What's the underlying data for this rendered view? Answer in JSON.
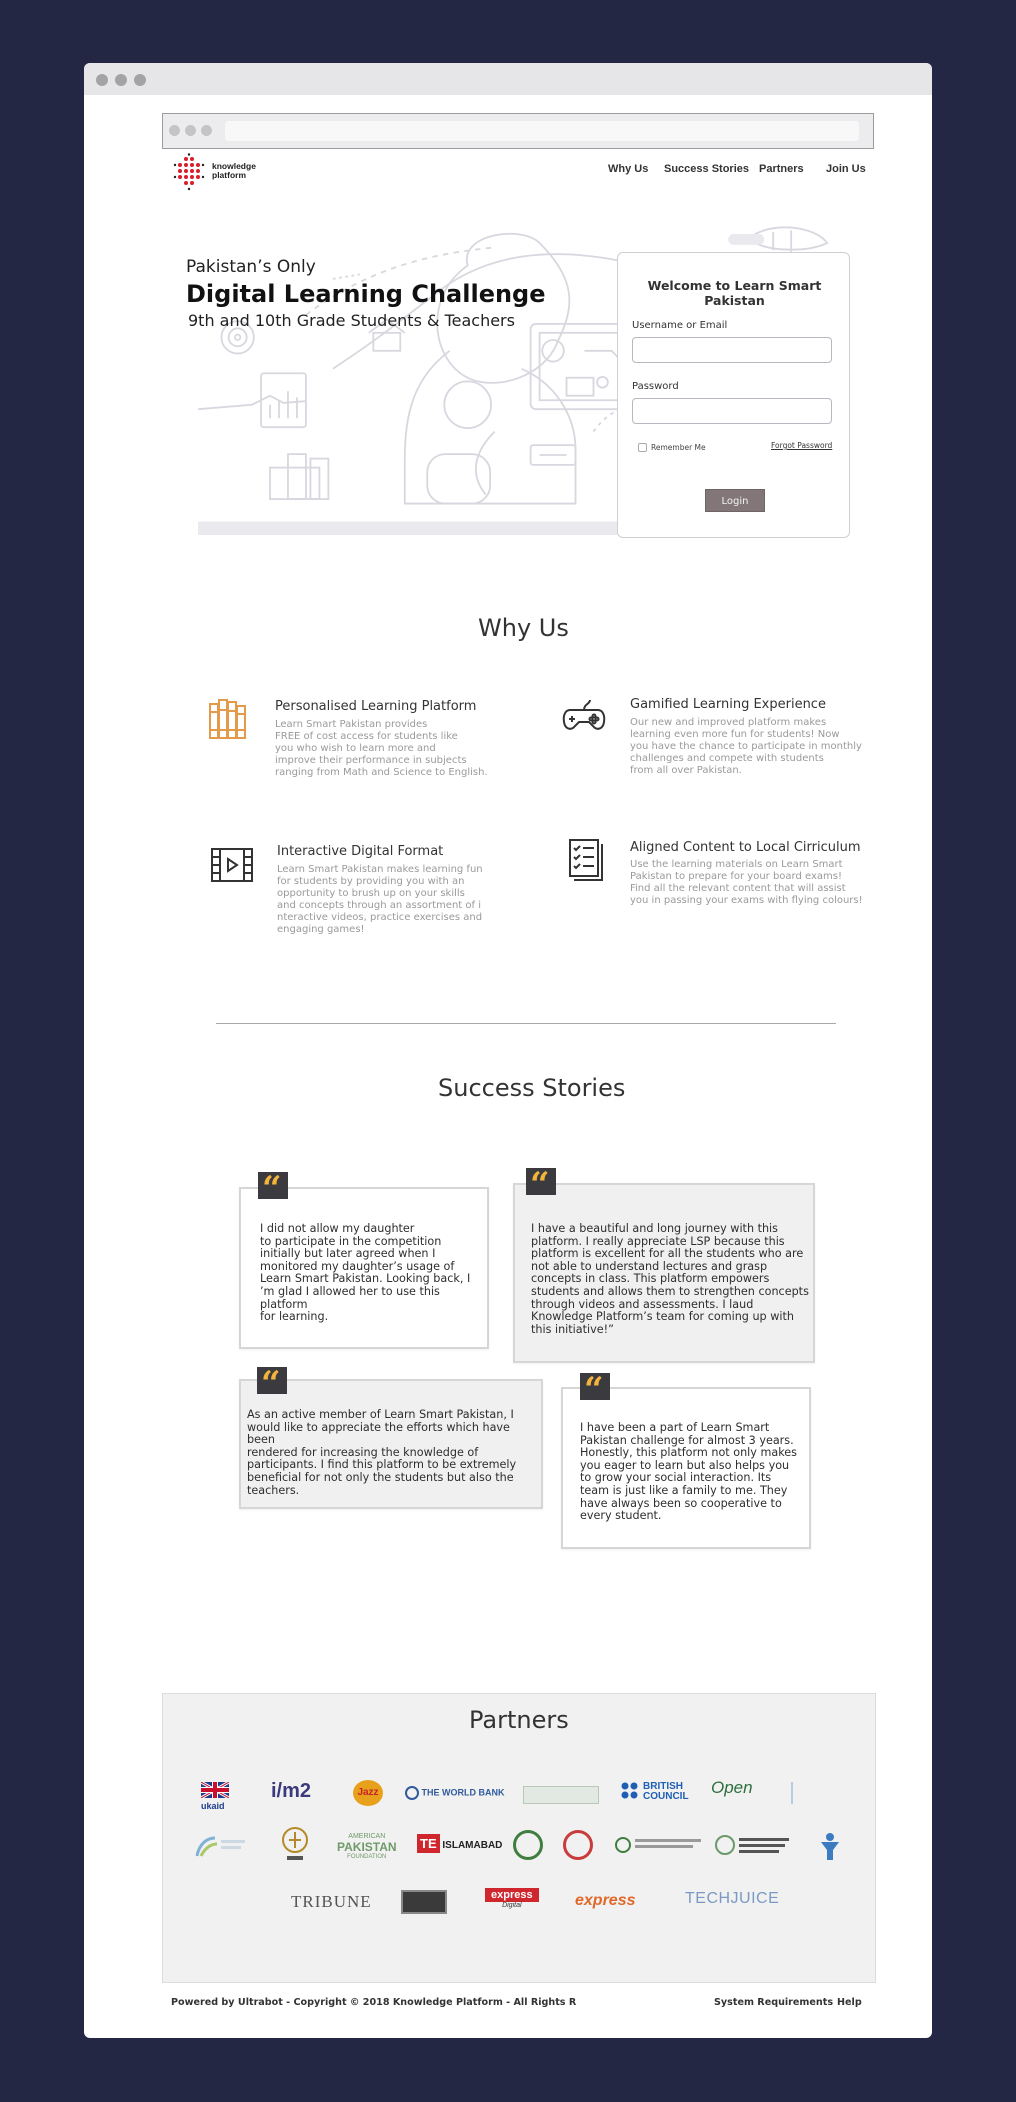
{
  "nav": {
    "why_us": "Why Us",
    "success_stories": "Success Stories",
    "partners": "Partners",
    "join_us": "Join Us"
  },
  "logo": {
    "line1": "knowledge",
    "line2": "platform"
  },
  "hero": {
    "line1": "Pakistan’s Only",
    "line2": "Digital Learning Challenge",
    "line3": "9th and 10th Grade Students & Teachers"
  },
  "login": {
    "title": "Welcome to Learn Smart Pakistan",
    "username_label": "Username or Email",
    "password_label": "Password",
    "remember_label": "Remember Me",
    "forgot_label": "Forgot Password",
    "button_label": "Login"
  },
  "why_us": {
    "title": "Why Us",
    "features": [
      {
        "title": "Personalised Learning Platform",
        "desc_lines": [
          "Learn Smart Pakistan provides",
          "FREE of cost access for students like",
          "you who wish to learn more and",
          "improve their performance in subjects",
          "ranging from Math and Science to English."
        ]
      },
      {
        "title": "Gamified Learning Experience",
        "desc_lines": [
          "Our new and improved platform makes",
          "learning even more fun for students! Now",
          "you have the chance to participate in monthly",
          "challenges and compete with students",
          "from all over Pakistan."
        ]
      },
      {
        "title": "Interactive Digital Format",
        "desc_lines": [
          "Learn Smart Pakistan makes learning fun",
          "for students by providing you with an",
          "opportunity to brush up on your skills",
          "and concepts through an assortment of i",
          "nteractive videos, practice exercises and",
          "engaging games!"
        ]
      },
      {
        "title": "Aligned Content to Local Cirriculum",
        "desc_lines": [
          "Use the learning materials on Learn Smart",
          "Pakistan to prepare for your board exams!",
          "Find all the relevant content that will assist",
          "you in passing your exams with flying colours!"
        ]
      }
    ]
  },
  "success_stories": {
    "title": "Success Stories",
    "stories": [
      {
        "lines": [
          "I did not allow my daughter",
          "to participate in the competition",
          "initially but later agreed when I",
          "monitored my daughter’s usage of",
          "Learn Smart Pakistan. Looking back, I",
          "’m glad I allowed her to use this platform",
          "for learning."
        ]
      },
      {
        "lines": [
          "I have a beautiful and long journey with this",
          "platform. I really appreciate LSP because this",
          "platform is excellent for all the students who are",
          "not able to understand lectures and grasp",
          "concepts in class. This platform empowers",
          "students and allows them to strengthen concepts",
          "through videos and assessments. I laud",
          "Knowledge Platform’s team for coming up with",
          "this initiative!”"
        ]
      },
      {
        "lines": [
          "As an active member of Learn Smart Pakistan, I",
          "would like to appreciate the efforts which have been",
          "rendered for increasing the knowledge of",
          "participants. I find this platform to be extremely",
          "beneficial for not only the students but also the",
          "teachers."
        ]
      },
      {
        "lines": [
          "I have been a part of Learn Smart",
          "Pakistan challenge for almost 3 years.",
          "Honestly, this platform not only makes",
          "you eager to learn but also helps you",
          "to grow your social interaction. Its",
          "team is just like a family to me. They",
          "have always been so cooperative to",
          "every student."
        ]
      }
    ]
  },
  "partners": {
    "title": "Partners",
    "logos": {
      "ukaid": "ukaid",
      "im2": "i/m2",
      "jazz": "Jazz",
      "world_bank": "THE WORLD BANK",
      "british_council_line1": "BRITISH",
      "british_council_line2": "COUNCIL",
      "open": "Open",
      "american_pakistan_line1": "AMERICAN",
      "american_pakistan_line2": "PAKISTAN",
      "american_pakistan_line3": "FOUNDATION",
      "te_islamabad_prefix": "TE",
      "te_islamabad": "ISLAMABAD",
      "tribune": "TRIBUNE",
      "express_line1": "express",
      "express_line2": "Digital",
      "express2": "express",
      "techjuice": "TECHJUICE"
    }
  },
  "footer": {
    "copyright": "Powered by Ultrabot - Copyright © 2018 Knowledge Platform - All Rights R",
    "system_requirements": "System Requirements",
    "help": "Help"
  },
  "colors": {
    "background": "#232743",
    "accent_quote": "#f4b43c",
    "login_button": "#827678"
  }
}
